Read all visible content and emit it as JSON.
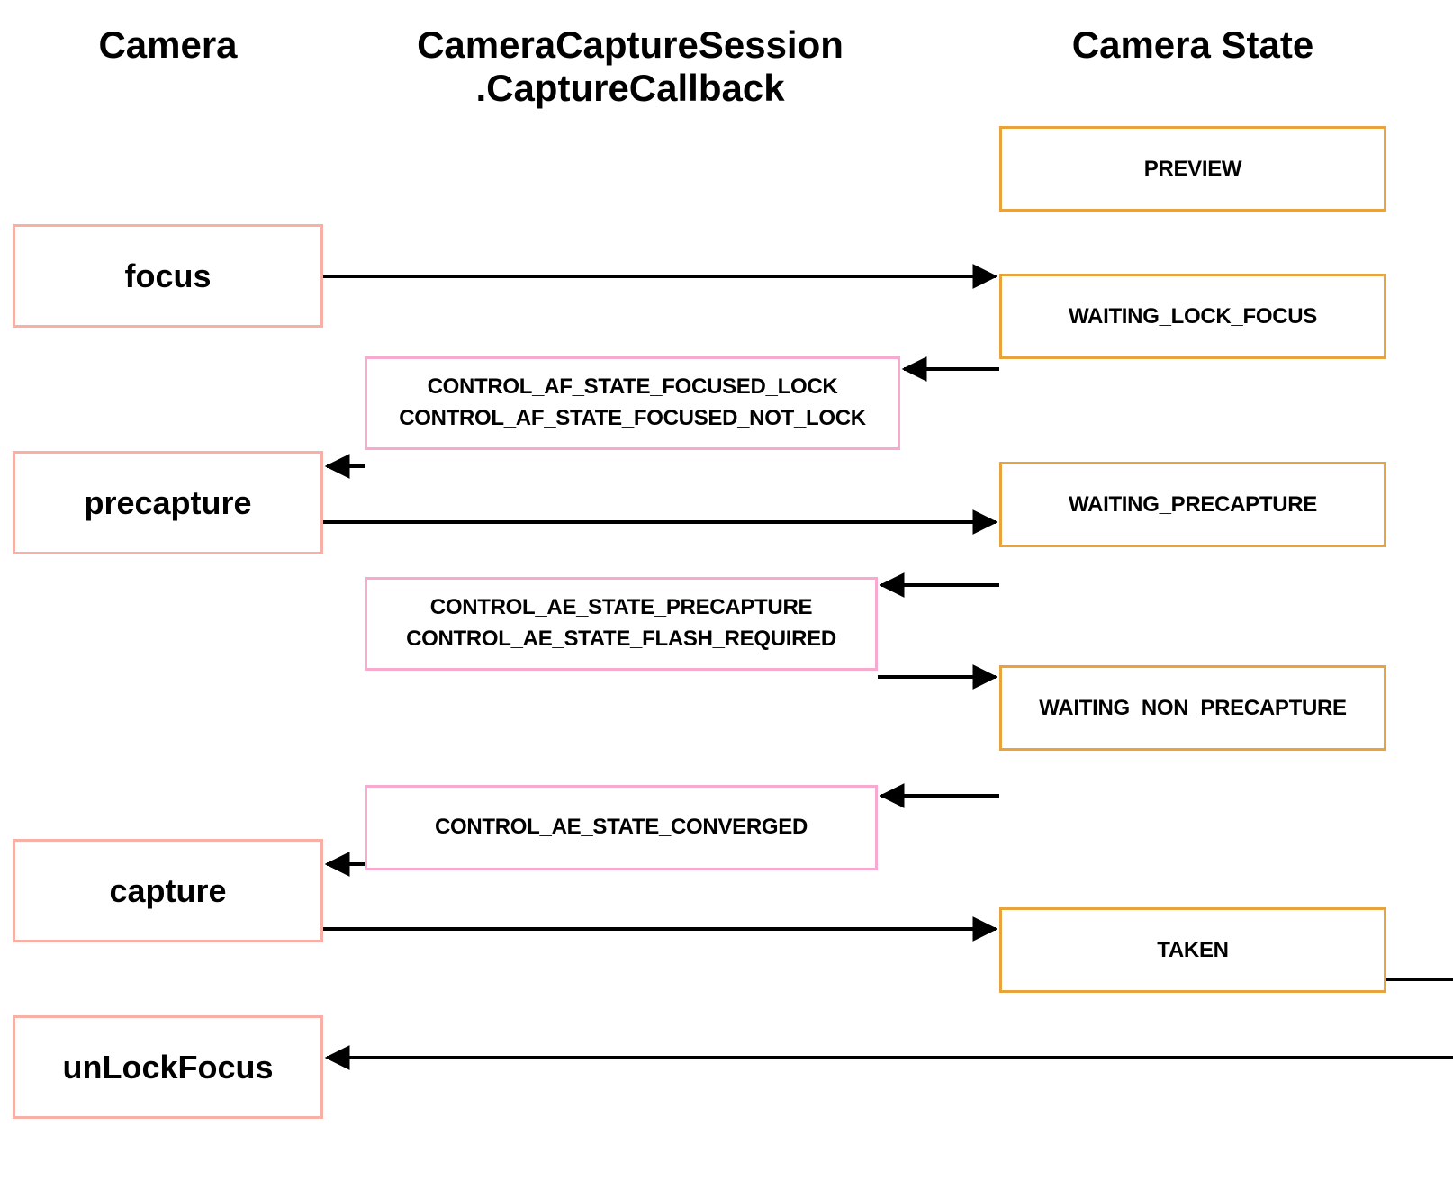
{
  "headings": {
    "camera": "Camera",
    "callback_line1": "CameraCaptureSession",
    "callback_line2": ".CaptureCallback",
    "state": "Camera State"
  },
  "camera": {
    "focus": "focus",
    "precapture": "precapture",
    "capture": "capture",
    "unlockFocus": "unLockFocus"
  },
  "callbacks": {
    "af1": "CONTROL_AF_STATE_FOCUSED_LOCK",
    "af2": "CONTROL_AF_STATE_FOCUSED_NOT_LOCK",
    "ae1": "CONTROL_AE_STATE_PRECAPTURE",
    "ae2": "CONTROL_AE_STATE_FLASH_REQUIRED",
    "aeConv": "CONTROL_AE_STATE_CONVERGED"
  },
  "states": {
    "preview": "PREVIEW",
    "waitingLockFocus": "WAITING_LOCK_FOCUS",
    "waitingPrecapture": "WAITING_PRECAPTURE",
    "waitingNonPrecapture": "WAITING_NON_PRECAPTURE",
    "taken": "TAKEN"
  }
}
